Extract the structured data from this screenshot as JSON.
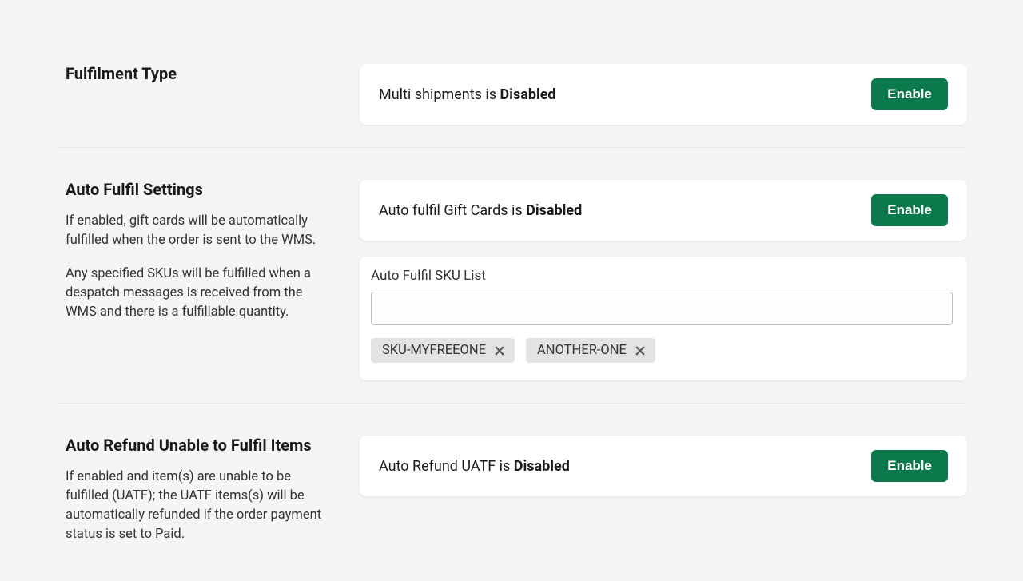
{
  "sections": {
    "fulfilmentType": {
      "title": "Fulfilment Type",
      "statusPrefix": "Multi shipments is ",
      "statusValue": "Disabled",
      "buttonLabel": "Enable"
    },
    "autoFulfil": {
      "title": "Auto Fulfil Settings",
      "descPara1": "If enabled, gift cards will be automatically fulfilled when the order is sent to the WMS.",
      "descPara2": "Any specified SKUs will be fulfilled when a despatch messages is received from the WMS and there is a fulfillable quantity.",
      "giftCards": {
        "statusPrefix": "Auto fulfil Gift Cards is ",
        "statusValue": "Disabled",
        "buttonLabel": "Enable"
      },
      "skuList": {
        "label": "Auto Fulfil SKU List",
        "inputValue": "",
        "tags": [
          "SKU-MYFREEONE",
          "ANOTHER-ONE"
        ]
      }
    },
    "autoRefund": {
      "title": "Auto Refund Unable to Fulfil Items",
      "desc": "If enabled and item(s) are unable to be fulfilled (UATF); the UATF items(s) will be automatically refunded if the order payment status is set to Paid.",
      "statusPrefix": "Auto Refund UATF is ",
      "statusValue": "Disabled",
      "buttonLabel": "Enable"
    }
  }
}
